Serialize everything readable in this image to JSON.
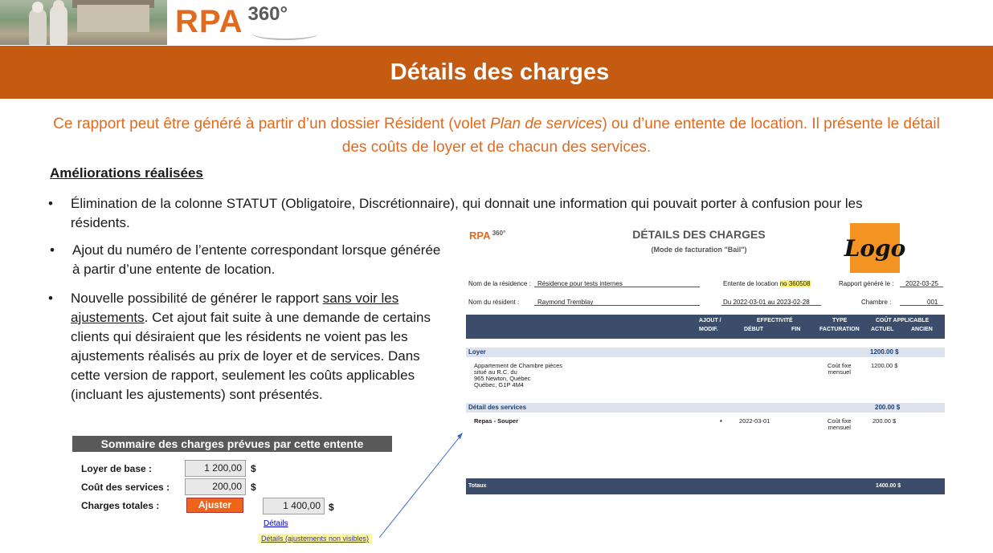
{
  "header": {
    "brand": "RPA",
    "brand_suffix": "360°",
    "title": "Détails des charges"
  },
  "intro": {
    "part1": "Ce rapport peut être généré à partir d’un dossier Résident (volet ",
    "italic": "Plan de services",
    "part2": ") ou d’une entente de location.  Il présente le détail des coûts de loyer et de chacun des services."
  },
  "ameliorations": {
    "heading": "Améliorations réalisées",
    "bullet1": "Élimination de la colonne STATUT (Obligatoire, Discrétionnaire), qui donnait une information qui pouvait porter à confusion pour les résidents.",
    "bullet2": "Ajout du numéro de l’entente correspondant lorsque générée à partir d’une entente de location.",
    "bullet3_a": "Nouvelle possibilité de générer le rapport ",
    "bullet3_u": "sans voir les ajustements",
    "bullet3_b": ".  Cet ajout fait suite à une demande de certains clients qui désiraient que les résidents ne voient pas les ajustements réalisés au prix de loyer et de services.  Dans cette version de rapport, seulement les coûts applicables (incluant les ajustements) sont présentés."
  },
  "summary": {
    "title": "Sommaire des charges prévues par cette entente",
    "rent_label": "Loyer de base :",
    "rent_value": "1 200,00",
    "services_label": "Coût des services :",
    "services_value": "200,00",
    "total_label": "Charges totales :",
    "adjust_button": "Ajuster",
    "total_value": "1 400,00",
    "currency": "$",
    "link_details": "Détails",
    "link_details_hidden": "Détails (ajustements non visibles)"
  },
  "report": {
    "brand": "RPA",
    "brand_suffix": "360°",
    "title": "DÉTAILS DES CHARGES",
    "subtitle": "(Mode de facturation \"Bail\")",
    "client_logo": "Logo",
    "residence_label": "Nom de la résidence :",
    "residence_value": "Résidence pour tests internes",
    "agreement_label": "Entente de location",
    "agreement_no": "no 360508",
    "generated_label": "Rapport généré le :",
    "generated_value": "2022-03-25",
    "resident_label": "Nom du résident :",
    "resident_value": "Raymond Tremblay",
    "period": "Du 2022-03-01 au 2023-02-28",
    "room_label": "Chambre :",
    "room_value": "001",
    "columns": {
      "ajout": "AJOUT /",
      "modif": "MODIF.",
      "effectivite": "EFFECTIVITÉ",
      "debut": "DÉBUT",
      "fin": "FIN",
      "type": "TYPE",
      "facturation": "FACTURATION",
      "cout": "COÛT APPLICABLE",
      "actuel": "ACTUEL",
      "ancien": "ANCIEN"
    },
    "loyer_section": "Loyer",
    "loyer_total": "1200.00 $",
    "loyer_desc1": "Appartement de Chambre pièces",
    "loyer_desc2": "situé au R.C. du",
    "loyer_desc3": "965 Newton, Québec",
    "loyer_desc4": "Québec, G1P 4M4",
    "loyer_type1": "Coût fixe",
    "loyer_type2": "mensuel",
    "loyer_amount": "1200.00 $",
    "services_section": "Détail des services",
    "services_total": "200.00 $",
    "service_name": "Repas - Souper",
    "service_mark": "*",
    "service_start": "2022-03-01",
    "service_type1": "Coût fixe",
    "service_type2": "mensuel",
    "service_amount": "200.00 $",
    "totals_label": "Totaux",
    "totals_value": "1400.00 $"
  },
  "colors": {
    "banner": "#c55a11",
    "accent": "#e26a1e",
    "table_header": "#3b4d6b",
    "highlight": "#fff36a"
  }
}
